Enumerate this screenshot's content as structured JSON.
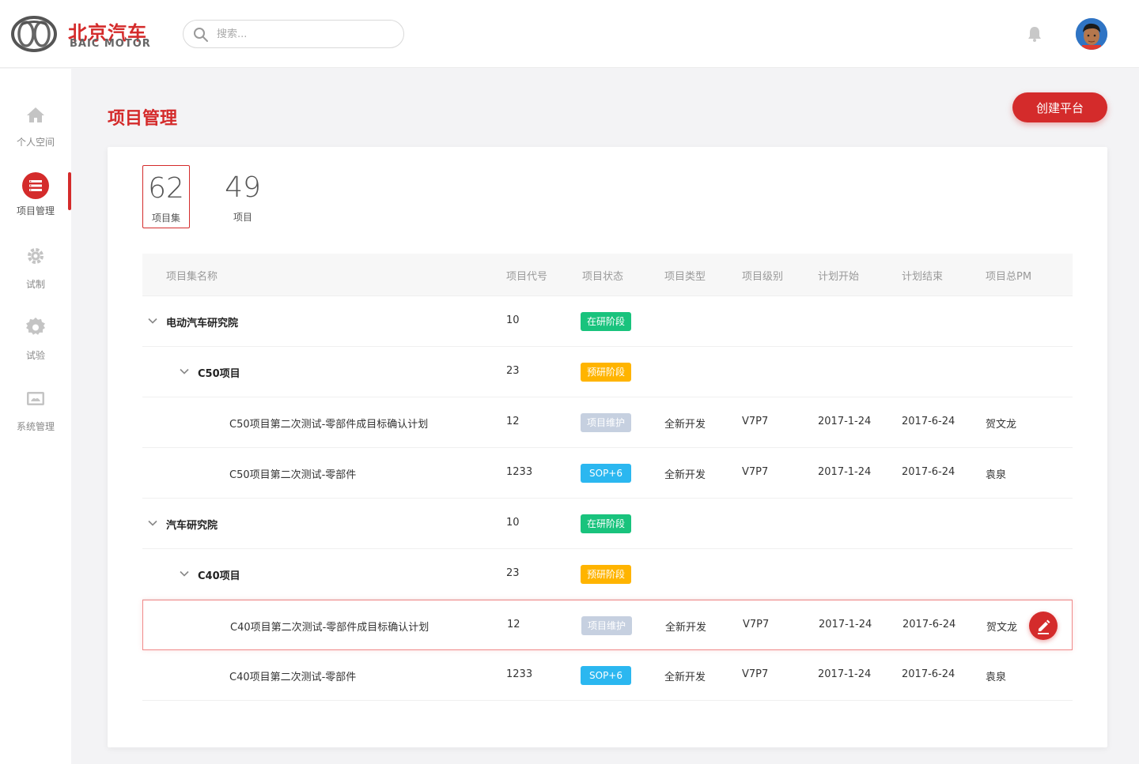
{
  "brand": {
    "name_cn": "北京汽车",
    "name_en": "BAIC MOTOR",
    "color": "#d42b2b"
  },
  "search": {
    "placeholder": "搜索..."
  },
  "sidebar": {
    "items": [
      {
        "label": "个人空间",
        "icon": "home-icon",
        "active": false
      },
      {
        "label": "项目管理",
        "icon": "list-icon",
        "active": true
      },
      {
        "label": "试制",
        "icon": "gear-icon",
        "active": false
      },
      {
        "label": "试验",
        "icon": "cog-icon",
        "active": false
      },
      {
        "label": "系统管理",
        "icon": "monitor-icon",
        "active": false
      }
    ]
  },
  "page": {
    "title": "项目管理",
    "create_label": "创建平台"
  },
  "stats": [
    {
      "value": "62",
      "label": "项目集",
      "active": true
    },
    {
      "value": "49",
      "label": "项目",
      "active": false
    }
  ],
  "table": {
    "headers": [
      "项目集名称",
      "项目代号",
      "项目状态",
      "项目类型",
      "项目级别",
      "计划开始",
      "计划结束",
      "项目总PM"
    ],
    "rows": [
      {
        "level": 0,
        "name": "电动汽车研究院",
        "code": "10",
        "status": "在研阶段",
        "status_color": "#19c37d",
        "type": "",
        "grade": "",
        "start": "",
        "end": "",
        "pm": ""
      },
      {
        "level": 1,
        "name": "C50项目",
        "code": "23",
        "status": "预研阶段",
        "status_color": "#ffb400",
        "type": "",
        "grade": "",
        "start": "",
        "end": "",
        "pm": ""
      },
      {
        "level": 2,
        "name": "C50项目第二次测试-零部件成目标确认计划",
        "code": "12",
        "status": "项目维护",
        "status_color": "#c6d0e0",
        "type": "全新开发",
        "grade": "V7P7",
        "start": "2017-1-24",
        "end": "2017-6-24",
        "pm": "贺文龙"
      },
      {
        "level": 2,
        "name": "C50项目第二次测试-零部件",
        "code": "1233",
        "status": "SOP+6",
        "status_color": "#2bb7f0",
        "type": "全新开发",
        "grade": "V7P7",
        "start": "2017-1-24",
        "end": "2017-6-24",
        "pm": "袁泉"
      },
      {
        "level": 0,
        "name": "汽车研究院",
        "code": "10",
        "status": "在研阶段",
        "status_color": "#19c37d",
        "type": "",
        "grade": "",
        "start": "",
        "end": "",
        "pm": ""
      },
      {
        "level": 1,
        "name": "C40项目",
        "code": "23",
        "status": "预研阶段",
        "status_color": "#ffb400",
        "type": "",
        "grade": "",
        "start": "",
        "end": "",
        "pm": ""
      },
      {
        "level": 2,
        "name": "C40项目第二次测试-零部件成目标确认计划",
        "code": "12",
        "status": "项目维护",
        "status_color": "#c6d0e0",
        "type": "全新开发",
        "grade": "V7P7",
        "start": "2017-1-24",
        "end": "2017-6-24",
        "pm": "贺文龙",
        "highlight": true
      },
      {
        "level": 2,
        "name": "C40项目第二次测试-零部件",
        "code": "1233",
        "status": "SOP+6",
        "status_color": "#2bb7f0",
        "type": "全新开发",
        "grade": "V7P7",
        "start": "2017-1-24",
        "end": "2017-6-24",
        "pm": "袁泉"
      }
    ]
  }
}
